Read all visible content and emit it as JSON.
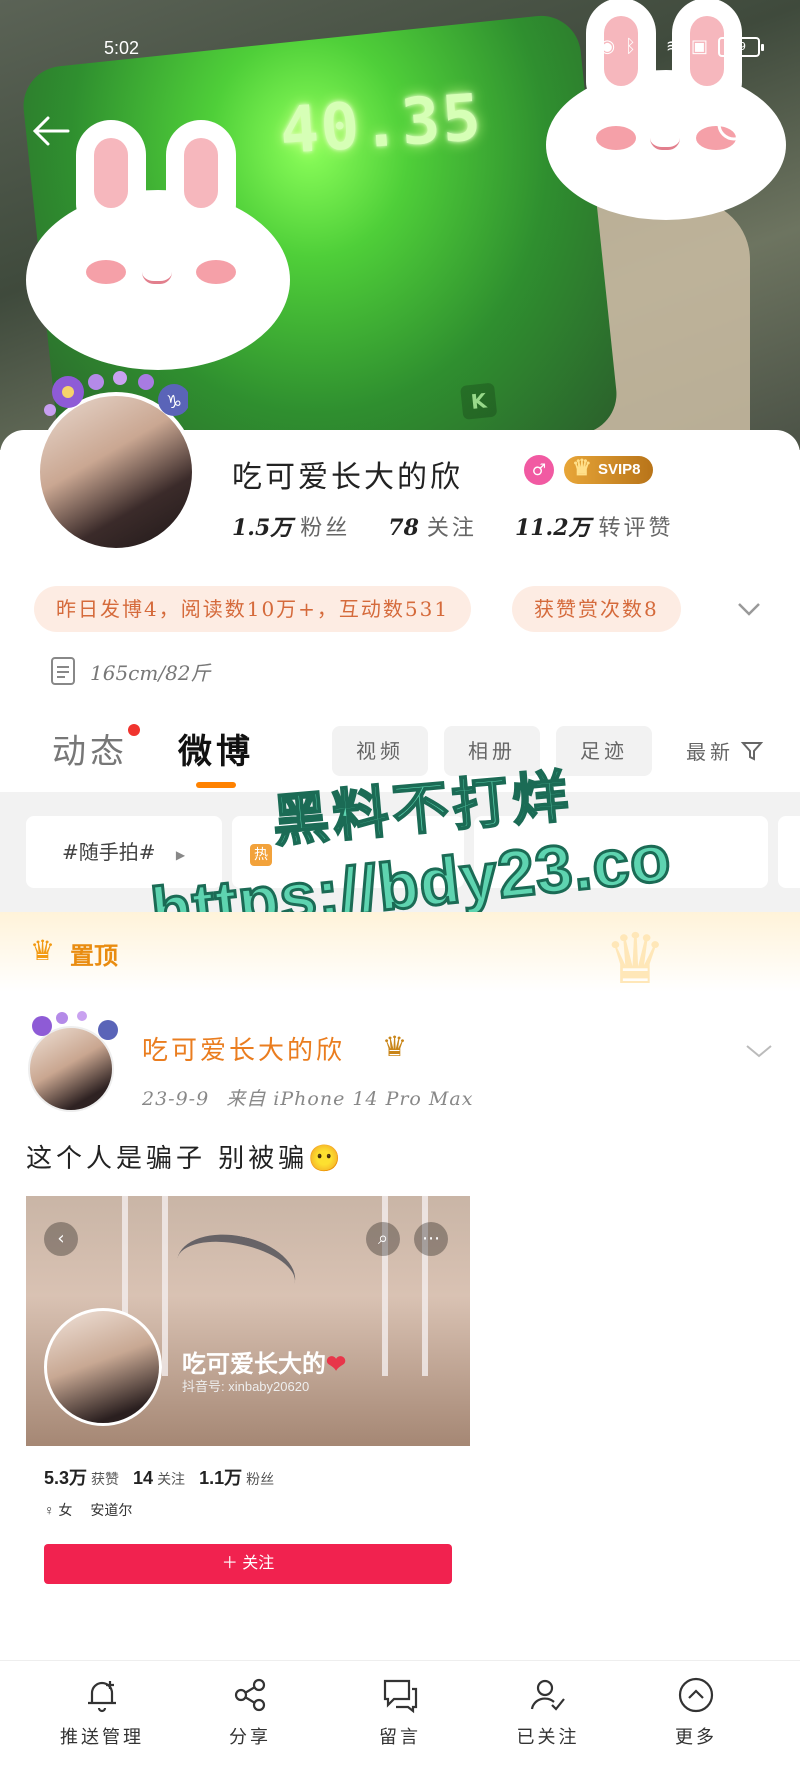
{
  "status_bar": {
    "time": "5:02",
    "battery": "39"
  },
  "cover": {
    "scale_reading": "40.35",
    "scale_brand": "K"
  },
  "profile": {
    "name": "吃可爱长大的欣",
    "gender_symbol": "♂",
    "vip_label": "SVIP8",
    "stats": [
      {
        "value": "1.5万",
        "label": "粉丝"
      },
      {
        "value": "78",
        "label": "关注"
      },
      {
        "value": "11.2万",
        "label": "转评赞"
      }
    ],
    "summary_chip": "昨日发博4，阅读数10万+，互动数531",
    "reward_chip": "获赞赏次数8",
    "height_weight": "165cm/82斤"
  },
  "tabs": {
    "dynamic": "动态",
    "weibo": "微博",
    "filters": [
      "视频",
      "相册",
      "足迹"
    ],
    "sort": "最新"
  },
  "topics": [
    "#随手拍#"
  ],
  "watermark": {
    "line1": "黑料不打烊",
    "line2": "https://bdy23.co"
  },
  "pinned": {
    "label": "置顶"
  },
  "post": {
    "author": "吃可爱长大的欣",
    "date": "23-9-9",
    "source": "来自 iPhone 14 Pro Max",
    "text": "这个人是骗子 别被骗😶",
    "screenshot": {
      "name": "吃可爱长大的",
      "heart": "❤",
      "douyin_id": "抖音号: xinbaby20620",
      "stats": [
        {
          "value": "5.3万",
          "label": "获赞"
        },
        {
          "value": "14",
          "label": "关注"
        },
        {
          "value": "1.1万",
          "label": "粉丝"
        }
      ],
      "gender": "♀ 女",
      "location": "安道尔",
      "follow_button": "＋ 关注"
    }
  },
  "bottom_bar": [
    "推送管理",
    "分享",
    "留言",
    "已关注",
    "更多"
  ]
}
